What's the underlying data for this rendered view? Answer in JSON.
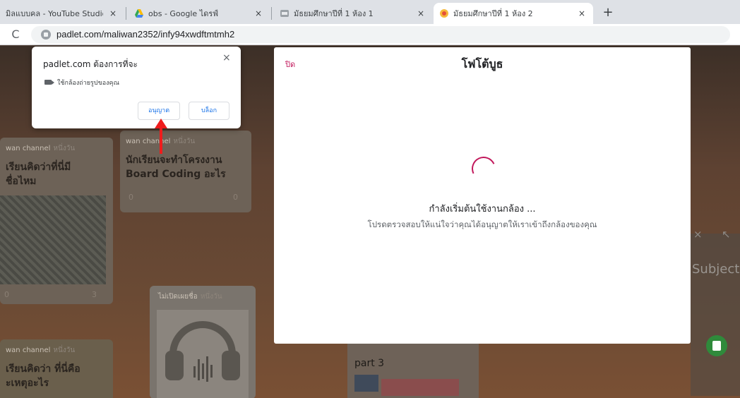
{
  "browser": {
    "tabs": [
      {
        "title": "มิลแบบคล - YouTube Studio",
        "icon": "youtube-studio-icon",
        "active": false
      },
      {
        "title": "obs - Google ไดรฟ์",
        "icon": "google-drive-icon",
        "active": false
      },
      {
        "title": "มัธยมศึกษาปีที่ 1 ห้อง 1",
        "icon": "padlet-icon",
        "active": false
      },
      {
        "title": "มัธยมศึกษาปีที่ 1 ห้อง 2",
        "icon": "padlet-icon",
        "active": true
      }
    ],
    "new_tab_label": "+",
    "tab_close_label": "×",
    "reload_glyph": "C",
    "url": "padlet.com/maliwan2352/infy94xwdftmtmh2"
  },
  "permission_popup": {
    "title": "padlet.com ต้องการที่จะ",
    "description": "ใช้กล้องถ่ายรูปของคุณ",
    "allow_label": "อนุญาต",
    "block_label": "บล็อก",
    "close_label": "×"
  },
  "modal": {
    "close_label": "ปิด",
    "title": "โฟโต้บูธ",
    "status": "กำลังเริ่มต้นใช้งานกล้อง ...",
    "hint": "โปรดตรวจสอบให้แน่ใจว่าคุณได้อนุญาตให้เราเข้าถึงกล้องของคุณ"
  },
  "board": {
    "cards": [
      {
        "author": "wan channel",
        "when": "หนึ่งวัน",
        "text_line1": "เรียนคิดว่าที่นี่มี",
        "text_line2": "ชื่อไหม",
        "reactions": "0",
        "comments": "3"
      },
      {
        "author": "wan channel",
        "when": "หนึ่งวัน",
        "text_line1": "นักเรียนจะทำโครงงาน",
        "text_line2": "Board Coding อะไร",
        "reactions": "0",
        "comments": "0"
      },
      {
        "author": "ไม่เปิดเผยชื่อ",
        "when": "หนึ่งวัน"
      },
      {
        "author": "wan channel",
        "when": "หนึ่งวัน",
        "text_line1": "เรียนคิดว่า ที่นี่คือ",
        "text_line2": "ะเหตุอะไร"
      },
      {
        "text_line1": "part 3"
      }
    ],
    "side_close": "×",
    "side_expand": "↖",
    "side_label": "Subject"
  },
  "colors": {
    "annotation_arrow": "#ef1c1c",
    "accent": "#c2185b",
    "link_blue": "#1a73e8"
  }
}
